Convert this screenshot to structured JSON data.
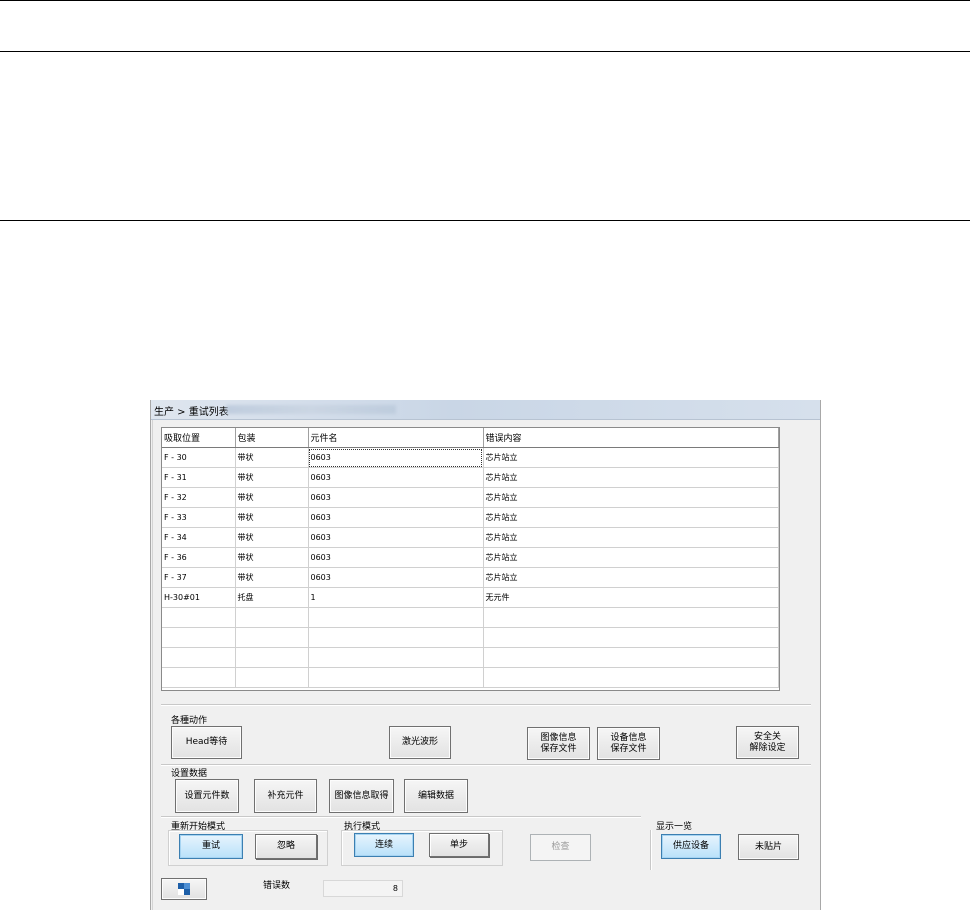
{
  "window": {
    "title": "生产 > 重试列表"
  },
  "table": {
    "headers": [
      "吸取位置",
      "包装",
      "元件名",
      "错误内容"
    ],
    "rows": [
      [
        "F - 30",
        "带状",
        "0603",
        "芯片站立"
      ],
      [
        "F - 31",
        "带状",
        "0603",
        "芯片站立"
      ],
      [
        "F - 32",
        "带状",
        "0603",
        "芯片站立"
      ],
      [
        "F - 33",
        "带状",
        "0603",
        "芯片站立"
      ],
      [
        "F - 34",
        "带状",
        "0603",
        "芯片站立"
      ],
      [
        "F - 36",
        "带状",
        "0603",
        "芯片站立"
      ],
      [
        "F - 37",
        "带状",
        "0603",
        "芯片站立"
      ],
      [
        "H-30#01",
        "托盘",
        "1",
        "无元件"
      ],
      [
        "",
        "",
        "",
        ""
      ],
      [
        "",
        "",
        "",
        ""
      ],
      [
        "",
        "",
        "",
        ""
      ],
      [
        "",
        "",
        "",
        ""
      ]
    ]
  },
  "actions": {
    "label": "各種动作",
    "head_wait": "Head等待",
    "laser_wave": "激光波形",
    "image_save": "图像信息\n保存文件",
    "device_save": "设备信息\n保存文件",
    "safety": "安全关\n解除设定"
  },
  "settings": {
    "label": "设置数据",
    "set_count": "设置元件数",
    "supplement": "补充元件",
    "image_get": "图像信息取得",
    "edit_data": "编辑数据"
  },
  "restart": {
    "label": "重新开始模式",
    "retry": "重试",
    "ignore": "忽略"
  },
  "exec": {
    "label": "执行模式",
    "continuous": "连续",
    "step": "单步",
    "check": "检查"
  },
  "display": {
    "label": "显示一览",
    "supply": "供应设备",
    "unplaced": "未贴片"
  },
  "footer": {
    "error_label": "错误数",
    "error_count": "8"
  }
}
